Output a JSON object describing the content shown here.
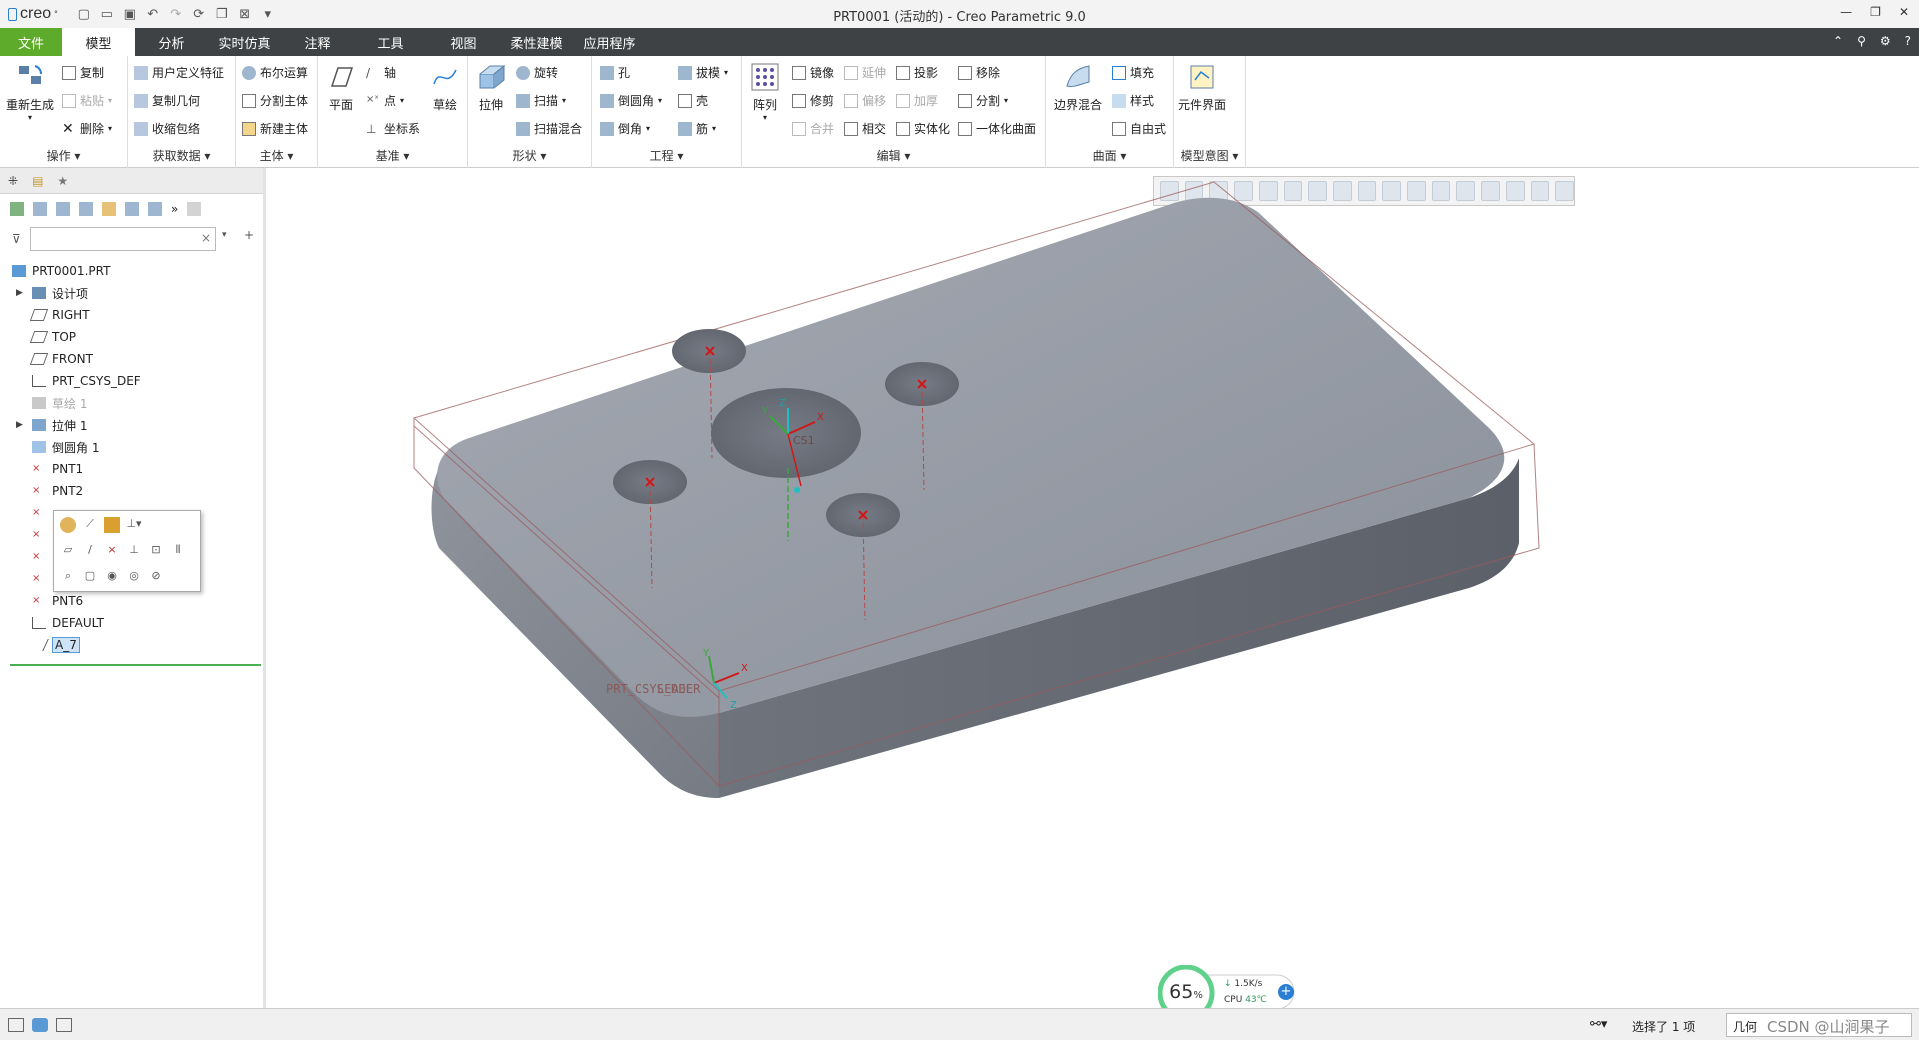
{
  "app": {
    "logo": "creo",
    "window_title": "PRT0001 (活动的) - Creo Parametric 9.0"
  },
  "tabs": [
    "文件",
    "模型",
    "分析",
    "实时仿真",
    "注释",
    "工具",
    "视图",
    "柔性建模",
    "应用程序"
  ],
  "active_tab": "模型",
  "ribbon": {
    "ops": {
      "regen": "重新生成",
      "copy": "复制",
      "paste": "粘贴",
      "delete": "删除",
      "label": "操作"
    },
    "getdata": {
      "udf": "用户定义特征",
      "copygeom": "复制几何",
      "shrinkwrap": "收缩包络",
      "label": "获取数据"
    },
    "body": {
      "boolean": "布尔运算",
      "split": "分割主体",
      "newbody": "新建主体",
      "label": "主体"
    },
    "datum": {
      "plane": "平面",
      "axis": "轴",
      "point": "点",
      "csys": "坐标系",
      "sketch": "草绘",
      "label": "基准"
    },
    "shapes": {
      "extrude": "拉伸",
      "revolve": "旋转",
      "sweep": "扫描",
      "swept_blend": "扫描混合",
      "label": "形状"
    },
    "eng": {
      "hole": "孔",
      "round": "倒圆角",
      "chamfer": "倒角",
      "draft": "拔模",
      "shell": "壳",
      "rib": "筋",
      "label": "工程"
    },
    "edit": {
      "pattern": "阵列",
      "mirror": "镜像",
      "extend": "延伸",
      "project": "投影",
      "remove": "移除",
      "trim": "修剪",
      "offset": "偏移",
      "thicken": "加厚",
      "split": "分割",
      "merge": "合并",
      "intersect": "相交",
      "solidify": "实体化",
      "unify": "一体化曲面",
      "label": "编辑"
    },
    "surfaces": {
      "boundary": "边界混合",
      "fill": "填充",
      "style": "样式",
      "freestyle": "自由式",
      "label": "曲面"
    },
    "intent": {
      "component": "元件界面",
      "label": "模型意图"
    }
  },
  "tree": {
    "root": "PRT0001.PRT",
    "items": [
      {
        "label": "设计项",
        "expand": true,
        "dim": false
      },
      {
        "label": "RIGHT",
        "expand": false,
        "dim": false
      },
      {
        "label": "TOP",
        "expand": false,
        "dim": false
      },
      {
        "label": "FRONT",
        "expand": false,
        "dim": false
      },
      {
        "label": "PRT_CSYS_DEF",
        "expand": false,
        "dim": false
      },
      {
        "label": "草绘 1",
        "expand": false,
        "dim": true
      },
      {
        "label": "拉伸 1",
        "expand": true,
        "dim": false
      },
      {
        "label": "倒圆角 1",
        "expand": false,
        "dim": false
      },
      {
        "label": "PNT1",
        "expand": false,
        "dim": false
      },
      {
        "label": "PNT2",
        "expand": false,
        "dim": false
      },
      {
        "label": "",
        "expand": false,
        "dim": false
      },
      {
        "label": "",
        "expand": false,
        "dim": false
      },
      {
        "label": "",
        "expand": false,
        "dim": false
      },
      {
        "label": "",
        "expand": false,
        "dim": false
      },
      {
        "label": "PNT6",
        "expand": false,
        "dim": false
      },
      {
        "label": "DEFAULT",
        "expand": false,
        "dim": false
      },
      {
        "label": "A_7",
        "expand": false,
        "dim": false
      }
    ]
  },
  "viewport": {
    "csys_label": "CS1",
    "prt_csys_label": "PRT_CSYS_DEF",
    "leader_label": "LEADER",
    "axis_x": "X",
    "axis_y": "Y",
    "axis_z": "Z"
  },
  "perf": {
    "percent": "65",
    "percent_unit": "%",
    "net": "1.5K/s",
    "cpu_label": "CPU",
    "cpu_temp": "43℃"
  },
  "status": {
    "selected": "选择了 1 项",
    "filter": "几何",
    "watermark": "CSDN @山涧果子"
  },
  "colors": {
    "accent_green": "#5eaa2a",
    "tabbar": "#3f4245",
    "model": "#8b919c"
  }
}
